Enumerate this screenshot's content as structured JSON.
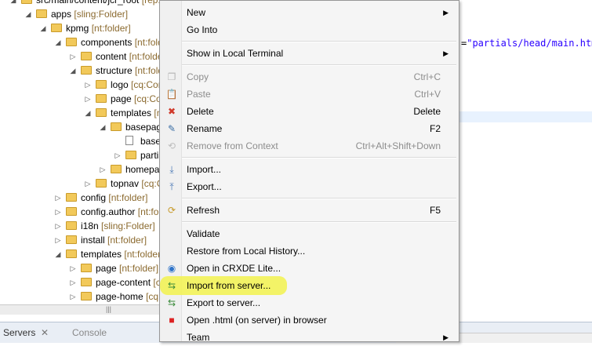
{
  "tree": {
    "items": [
      {
        "name": "src/main/content/jcr_root",
        "type": "[rep:root]",
        "twisty": "open",
        "icon": "folder"
      },
      {
        "name": "apps",
        "type": "[sling:Folder]",
        "twisty": "open",
        "icon": "folder"
      },
      {
        "name": "kpmg",
        "type": "[nt:folder]",
        "twisty": "open",
        "icon": "folder"
      },
      {
        "name": "components",
        "type": "[nt:folder]",
        "twisty": "open",
        "icon": "folder"
      },
      {
        "name": "content",
        "type": "[nt:folder]",
        "twisty": "closed",
        "icon": "folder"
      },
      {
        "name": "structure",
        "type": "[nt:folder]",
        "twisty": "open",
        "icon": "folder"
      },
      {
        "name": "logo",
        "type": "[cq:Component]",
        "twisty": "closed",
        "icon": "folder"
      },
      {
        "name": "page",
        "type": "[cq:Component]",
        "twisty": "closed",
        "icon": "folder"
      },
      {
        "name": "templates",
        "type": "[nt:folder]",
        "twisty": "open",
        "icon": "folder"
      },
      {
        "name": "basepage",
        "type": "",
        "twisty": "open",
        "icon": "folder"
      },
      {
        "name": "basepage",
        "type": "",
        "twisty": "none",
        "icon": "file"
      },
      {
        "name": "partials",
        "type": "",
        "twisty": "closed",
        "icon": "folder"
      },
      {
        "name": "homepage",
        "type": "",
        "twisty": "closed",
        "icon": "folder"
      },
      {
        "name": "topnav",
        "type": "[cq:Component]",
        "twisty": "closed",
        "icon": "folder"
      },
      {
        "name": "config",
        "type": "[nt:folder]",
        "twisty": "closed",
        "icon": "folder"
      },
      {
        "name": "config.author",
        "type": "[nt:folder]",
        "twisty": "closed",
        "icon": "folder"
      },
      {
        "name": "i18n",
        "type": "[sling:Folder]",
        "twisty": "closed",
        "icon": "folder"
      },
      {
        "name": "install",
        "type": "[nt:folder]",
        "twisty": "closed",
        "icon": "folder"
      },
      {
        "name": "templates",
        "type": "[nt:folder]",
        "twisty": "open",
        "icon": "folder"
      },
      {
        "name": "page",
        "type": "[nt:folder]",
        "twisty": "closed",
        "icon": "folder"
      },
      {
        "name": "page-content",
        "type": "[cq:Template]",
        "twisty": "closed",
        "icon": "folder"
      },
      {
        "name": "page-home",
        "type": "[cq:Template]",
        "twisty": "closed",
        "icon": "folder"
      }
    ]
  },
  "editor": {
    "top_text": "<head data-sly-include=\"partials/head/main.html\"></head>",
    "code_eq": "=",
    "code_value": "\"partials/head/main.html"
  },
  "bottom_tabs": {
    "servers": "Servers",
    "console": "Console"
  },
  "context_menu": {
    "items": [
      {
        "kind": "item",
        "label": "New",
        "shortcut": "",
        "submenu": true,
        "disabled": false,
        "icon": ""
      },
      {
        "kind": "item",
        "label": "Go Into",
        "shortcut": "",
        "submenu": false,
        "disabled": false,
        "icon": ""
      },
      {
        "kind": "sep"
      },
      {
        "kind": "item",
        "label": "Show in Local Terminal",
        "shortcut": "",
        "submenu": true,
        "disabled": false,
        "icon": ""
      },
      {
        "kind": "sep"
      },
      {
        "kind": "item",
        "label": "Copy",
        "shortcut": "Ctrl+C",
        "submenu": false,
        "disabled": true,
        "icon": "copy-icon"
      },
      {
        "kind": "item",
        "label": "Paste",
        "shortcut": "Ctrl+V",
        "submenu": false,
        "disabled": true,
        "icon": "paste-icon"
      },
      {
        "kind": "item",
        "label": "Delete",
        "shortcut": "Delete",
        "submenu": false,
        "disabled": false,
        "icon": "delete-icon"
      },
      {
        "kind": "item",
        "label": "Rename",
        "shortcut": "F2",
        "submenu": false,
        "disabled": false,
        "icon": "rename-icon"
      },
      {
        "kind": "item",
        "label": "Remove from Context",
        "shortcut": "Ctrl+Alt+Shift+Down",
        "submenu": false,
        "disabled": true,
        "icon": "remove-context-icon"
      },
      {
        "kind": "sep"
      },
      {
        "kind": "item",
        "label": "Import...",
        "shortcut": "",
        "submenu": false,
        "disabled": false,
        "icon": "import-icon"
      },
      {
        "kind": "item",
        "label": "Export...",
        "shortcut": "",
        "submenu": false,
        "disabled": false,
        "icon": "export-icon"
      },
      {
        "kind": "sep"
      },
      {
        "kind": "item",
        "label": "Refresh",
        "shortcut": "F5",
        "submenu": false,
        "disabled": false,
        "icon": "refresh-icon"
      },
      {
        "kind": "sep"
      },
      {
        "kind": "item",
        "label": "Validate",
        "shortcut": "",
        "submenu": false,
        "disabled": false,
        "icon": ""
      },
      {
        "kind": "item",
        "label": "Restore from Local History...",
        "shortcut": "",
        "submenu": false,
        "disabled": false,
        "icon": ""
      },
      {
        "kind": "item",
        "label": "Open in CRXDE Lite...",
        "shortcut": "",
        "submenu": false,
        "disabled": false,
        "icon": "crxde-icon"
      },
      {
        "kind": "item",
        "label": "Import from server...",
        "shortcut": "",
        "submenu": false,
        "disabled": false,
        "icon": "server-sync-icon",
        "highlighted": true
      },
      {
        "kind": "item",
        "label": "Export to server...",
        "shortcut": "",
        "submenu": false,
        "disabled": false,
        "icon": "server-sync-icon"
      },
      {
        "kind": "item",
        "label": "Open .html (on server) in browser",
        "shortcut": "",
        "submenu": false,
        "disabled": false,
        "icon": "browser-stop-icon"
      },
      {
        "kind": "item",
        "label": "Team",
        "shortcut": "",
        "submenu": true,
        "disabled": false,
        "icon": ""
      }
    ]
  },
  "colors": {
    "highlight": "#f2f25a",
    "delete_icon": "#d03a2b",
    "string_literal": "#2a00ff"
  }
}
